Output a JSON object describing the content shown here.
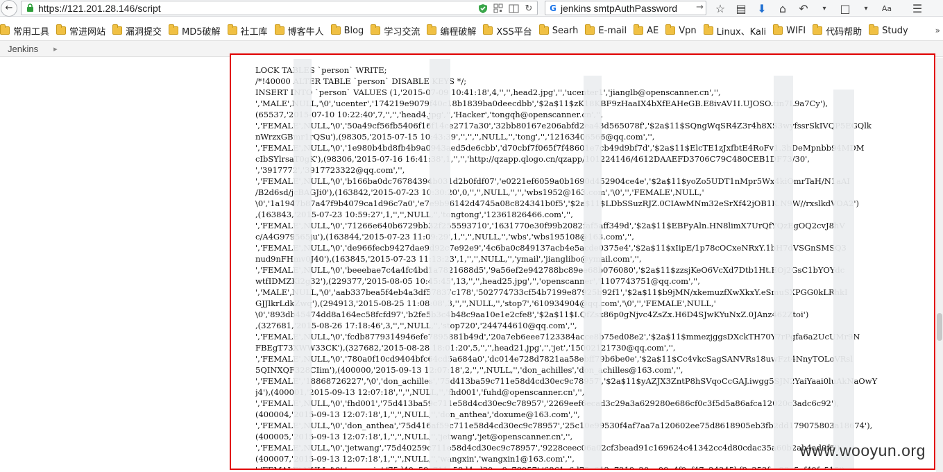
{
  "nav": {
    "url": "https://121.201.28.146/script",
    "search_query": "jenkins smtpAuthPassword"
  },
  "bookmarks": [
    {
      "label": "常用工具"
    },
    {
      "label": "常进网站"
    },
    {
      "label": "漏洞提交"
    },
    {
      "label": "MD5破解"
    },
    {
      "label": "社工库"
    },
    {
      "label": "博客牛人"
    },
    {
      "label": "Blog"
    },
    {
      "label": "学习交流"
    },
    {
      "label": "编程破解"
    },
    {
      "label": "XSS平台"
    },
    {
      "label": "Searh"
    },
    {
      "label": "E-mail"
    },
    {
      "label": "AE"
    },
    {
      "label": "Vpn"
    },
    {
      "label": "Linux、Kali"
    },
    {
      "label": "WIFI"
    },
    {
      "label": "代码帮助"
    },
    {
      "label": "Study"
    }
  ],
  "breadcrumb": {
    "root": "Jenkins",
    "separator": "▸"
  },
  "output": {
    "lines": [
      "LOCK TABLES `person` WRITE;",
      "/*!40000 ALTER TABLE `person` DISABLE KEYS */;",
      "INSERT INTO `person` VALUES (1,'2015-07-09 10:41:18',4,'','',head2.jpg','','ucenter1','jianglb@openscanner.cn','',",
      "','MALE',NULL,'\\0','ucenter','174219e9079f40c18b1839ba0deecdbb','$2a$11$zK18KBF9zHaaIX4bXfEAHeGB.E8ivAV1I.UJOSO.tin7L9a7Cy'),",
      "(65537,'2015-07-10 10:22:40',7,'','','head4.jpg','','Hacker','tongqh@openscanner.cn','',",
      "','FEMALE',NULL,'\\0','50a49cf56fb5406f16f14ce2717a30','32bb80167e206abfd2ea43d565078f','$2a$11$SQngWqSR4Z3r4h8XS3wyfssrSkIVQP5EGQlk",
      "nWrzxGBmr1rQSu'),(98305,'2015-07-15 10:43:39','','','',NULL,'','tong','','12163406566@qq.com','',",
      "','FEMALE',NULL,'\\0','1e980b4bd8fb4b9a0943aed5de6cbb','d70cbf7f065f7f48601e7cb49d9bf7d','$2a$11$ElcTE1zJxfbtE4RoFv1.3hDeMpnbb94MDM",
      "cIbSYlrsaT0gK'),(98306,'2015-07-16 16:41:38',1,'','','http://qzapp.qlogo.cn/qzapp/101224146/4612DAAEFD3706C79C480CEB1DF73/30',",
      "','3917772','3917723322@qq.com','',",
      "','FEMALE',NULL,'\\0','b166ba0dc76784394b031d2b0fdf07','e0221ef6059a0b1690d452904ce4e','$2a$11$yoZo5UDT1nMpr5Wx4kiOmrTaH/N1aAI",
      "/B2d6sd/jcBAGJi0'),(163842,'2015-07-23 10:30:20',0,'','',NULL,'','','wbs1952@163.com','\\0','','FEMALE',NULL,'",
      "\\0','1a1947b87a47f9b4079ca1d96c7a0','e7e9b96142d4745a08c824341b0f5','$2a$11$LDbSSuzRJZ.0CIAwMNm32eSrXf42jOB1K.N9W//rxslkdVOA2')",
      ",(163843,'2015-07-23 10:59:27',1,'','',NULL,'','tongtong','12361826466.com','',",
      "','FEMALE',NULL,'\\0','71266e640b6729bb32f255593710','1631770e30f99b2082faf5aff349d','$2a$11$EBFyAln.HN8limX7UrQfYQzEgOQ2cvJ8hV",
      "c/A4G979565ju'),(163844,'2015-07-23 11:09:29',1,'','',NULL,'','wbs','wbs195108@163.com','',",
      "','FEMALE',NULL,'\\0','de966fecb9427dae9d92c7e92e9','4c6ba0c849137acb4e5acde0375e4','$2a$11$xIipE/1p78cOCxeNRxY.1bH7dVSGnSMSQ3",
      "nud9nFHmv0J40'),(163845,'2015-07-23 11:13:23',1,'','',NULL,'','ymail','jianglibo@ymail.com','',",
      "','FEMALE',NULL,'\\0','beeebae7c4a4fc4bd1a7821688d5','9a56ef2e942788bc89ee68b076080','$2a$11$zzsjKeO6VcXd7Dtb1Ht.EOj2GsC1bYOYdc",
      "wtfIDMZKi2g32'),(229377,'2015-08-05 10:45:45',13,'','',head25.jpg','','openscanner','1107743751@qq.com','',",
      "','MALE',NULL,'\\0','aab337bea5f4eb4a3df57837c178','502774733cf54b7199e87925b92f1','$2a$11$b9jMN/xkemuzfXwXkxY.eSmuSXPGG0kLRhkI",
      "GJJlkrLdkZwq'),(294913,'2015-08-25 11:08:08',3,'','',NULL,'','stop7','610934904@qq.com','\\0','','FEMALE',NULL,'",
      "\\0','893db45474dd8a164ec58fcfd97','b2fe5b3c4b48c9aa10e1e2cfe8','$2a$11$I.QfZsx86p0gNjvc4ZsZx.H6D4SJwKYuNxZ.0JAnz462Ztoi')",
      ",(327681,'2015-08-26 17:18:46',3,'','',NULL,'','stop720','244744610@qq.com','',",
      "','FEMALE',NULL,'\\0','fcdb8779314946efe7895881b49d','20a7eb6eee7123384acce8b75ed08e2','$2a$11$mmezjggsDXckTH70Y7rPgfa6a2UcUMr9N",
      "FBEgT73XWW33CK'),(327682,'2015-08-28 18:01:20',5,'','',head21.jpg','','jet','15002121730@qq.com','',",
      "','FEMALE',NULL,'\\0','780a0f10cd9404bfc64cd5a684a0','dc014e728d7821aa58ebff79b6be0e','$2a$11$Cc4vkcSagSANVRs18uwFzt4NnyTOLoVRsl",
      "5QINXQF328CIim'),(400000,'2015-09-13 12:07:18',2,'','',NULL,'','don_achilles','don_achilles@163.com','',",
      "','FEMALE','18868726227','\\0','don_achilles','75d413ba59c711e58d4cd30ec9c78957','$2a$11$yAZJX3ZntP8hSVqoCcGAJ.iwgg5SJN2YaiYaai0luAkNaOwY",
      "j4'),(400001,'2015-09-13 12:07:18','','',NULL,'','fhd001','fuhd@openscanner.cn','',",
      "','FEMALE',NULL,'\\0','fhd001','75d413ba59c711e58d4cd30ec9c78957','2269eef6ecad3c29a3a629280e686cf0c3f5d5a86afca12020c3adc6c92'),",
      "(400004,'2015-09-13 12:07:18',1,'','',NULL,'','don_anthea','doxume@163.com','',",
      "','FEMALE',NULL,'\\0','don_anthea','75d416af59c711e58d4cd30ec9c78957','25c10e99530f4af7aa7a120602ee75d8618905eb3fb2dd179075803a18674'),",
      "(400005,'2015-09-13 12:07:18',1,'','',NULL,'','jetwang','jet@openscanner.cn','',",
      "','FEMALE',NULL,'\\0','jetwang','75d40259c711e58d4cd30ec9c78957','9228ceec06a02cf3bead91c169624c41342cc4d80cdac35a60b2ab4ad0f6'),",
      "(400007,'2015-09-13 12:07:18',1,'','',NULL,'','wangxin','wangxin1@163.com','',",
      "','FEMALE',NULL,'\\0','wangxin','75d40a59c711e58d4cd30ec9c78957','6861a6d75e612e7219c20ee99e4f9cf47e24345bf8c353fce23e5cf49fc515'),"
    ]
  },
  "watermark": "www.wooyun.org",
  "colors": {
    "highlight_border": "#e00000",
    "folder": "#f0c043"
  }
}
